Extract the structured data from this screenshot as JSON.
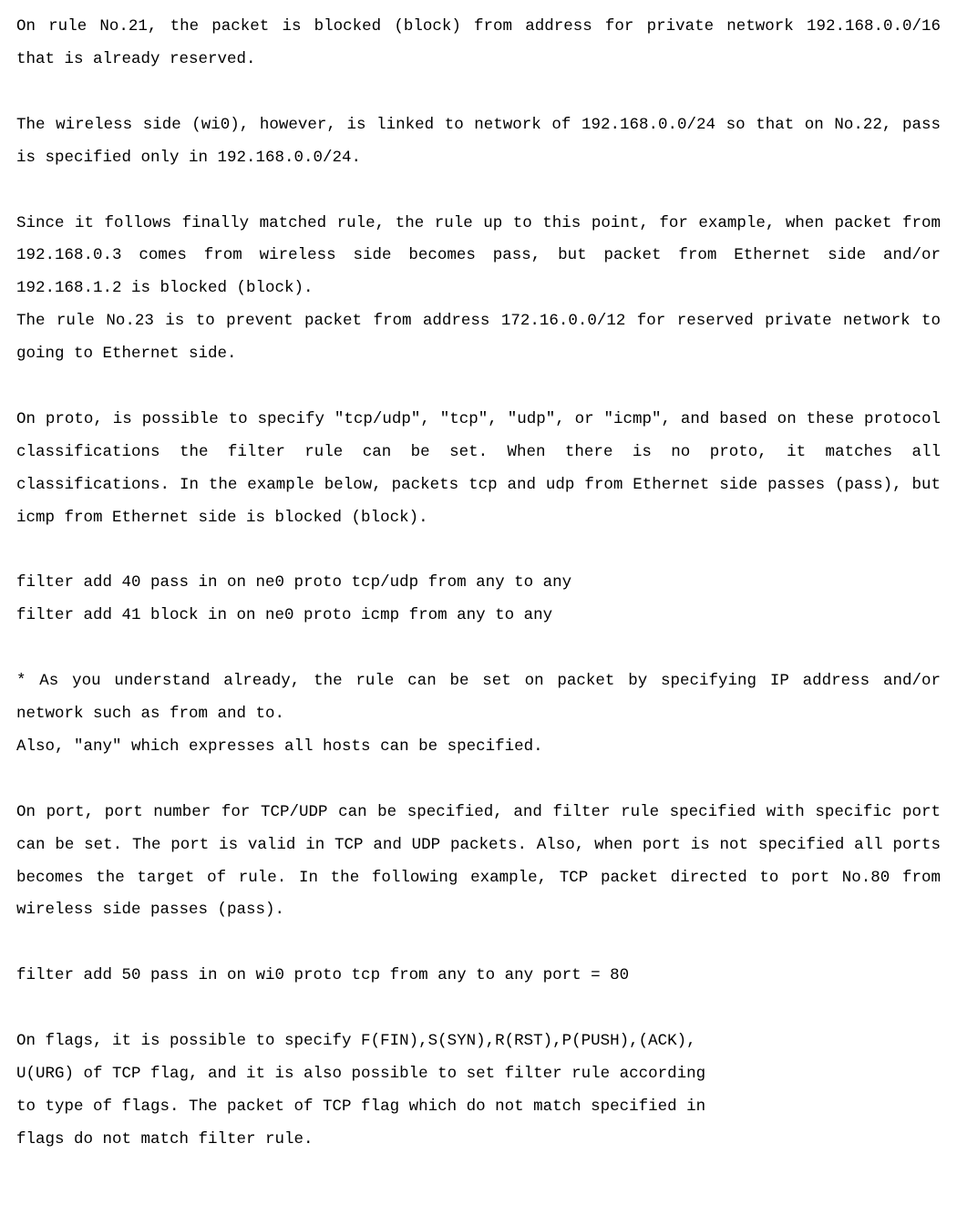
{
  "paragraphs": {
    "p1": "On rule No.21, the packet is blocked (block) from address for private network 192.168.0.0/16 that is already reserved.",
    "p2": "The wireless side (wi0), however, is linked to network of 192.168.0.0/24 so that on No.22, pass is specified only in 192.168.0.0/24.",
    "p3": "Since it follows finally matched rule, the rule up to this point, for example, when packet from 192.168.0.3 comes from wireless side becomes pass, but packet from Ethernet side and/or 192.168.1.2 is blocked (block).",
    "p4": "The rule No.23 is to prevent packet from address 172.16.0.0/12 for reserved private network to going to Ethernet side.",
    "p5": "On proto, is possible to specify \"tcp/udp\", \"tcp\", \"udp\", or \"icmp\", and  based on these protocol classifications the filter rule can be set. When there is no proto, it matches all classifications. In the example below, packets tcp and udp from Ethernet side passes (pass), but icmp from Ethernet side is blocked (block).",
    "cmd1": "filter add 40 pass in on ne0 proto tcp/udp from any to any",
    "cmd2": "filter add 41 block in on ne0 proto icmp from any to any",
    "p6": "* As you understand already, the rule can be set on packet by specifying IP address and/or network such as from and to.",
    "p7": "Also, \"any\" which expresses all hosts can be specified.",
    "p8": "On port, port number for TCP/UDP can be specified, and filter rule specified with specific port can be set. The port is valid in TCP and UDP packets. Also, when port is not specified all ports becomes the target of rule. In the following example, TCP packet directed to port No.80 from wireless side passes (pass).",
    "cmd3": "filter add 50 pass in on wi0 proto tcp from any to any port = 80",
    "p9a": "On flags, it is possible to specify F(FIN),S(SYN),R(RST),P(PUSH),(ACK),",
    "p9b": "U(URG) of TCP flag, and it is also possible to set filter rule according",
    "p9c": "to type of flags. The packet of TCP flag which do not match specified in",
    "p9d": "flags do not match filter rule."
  }
}
